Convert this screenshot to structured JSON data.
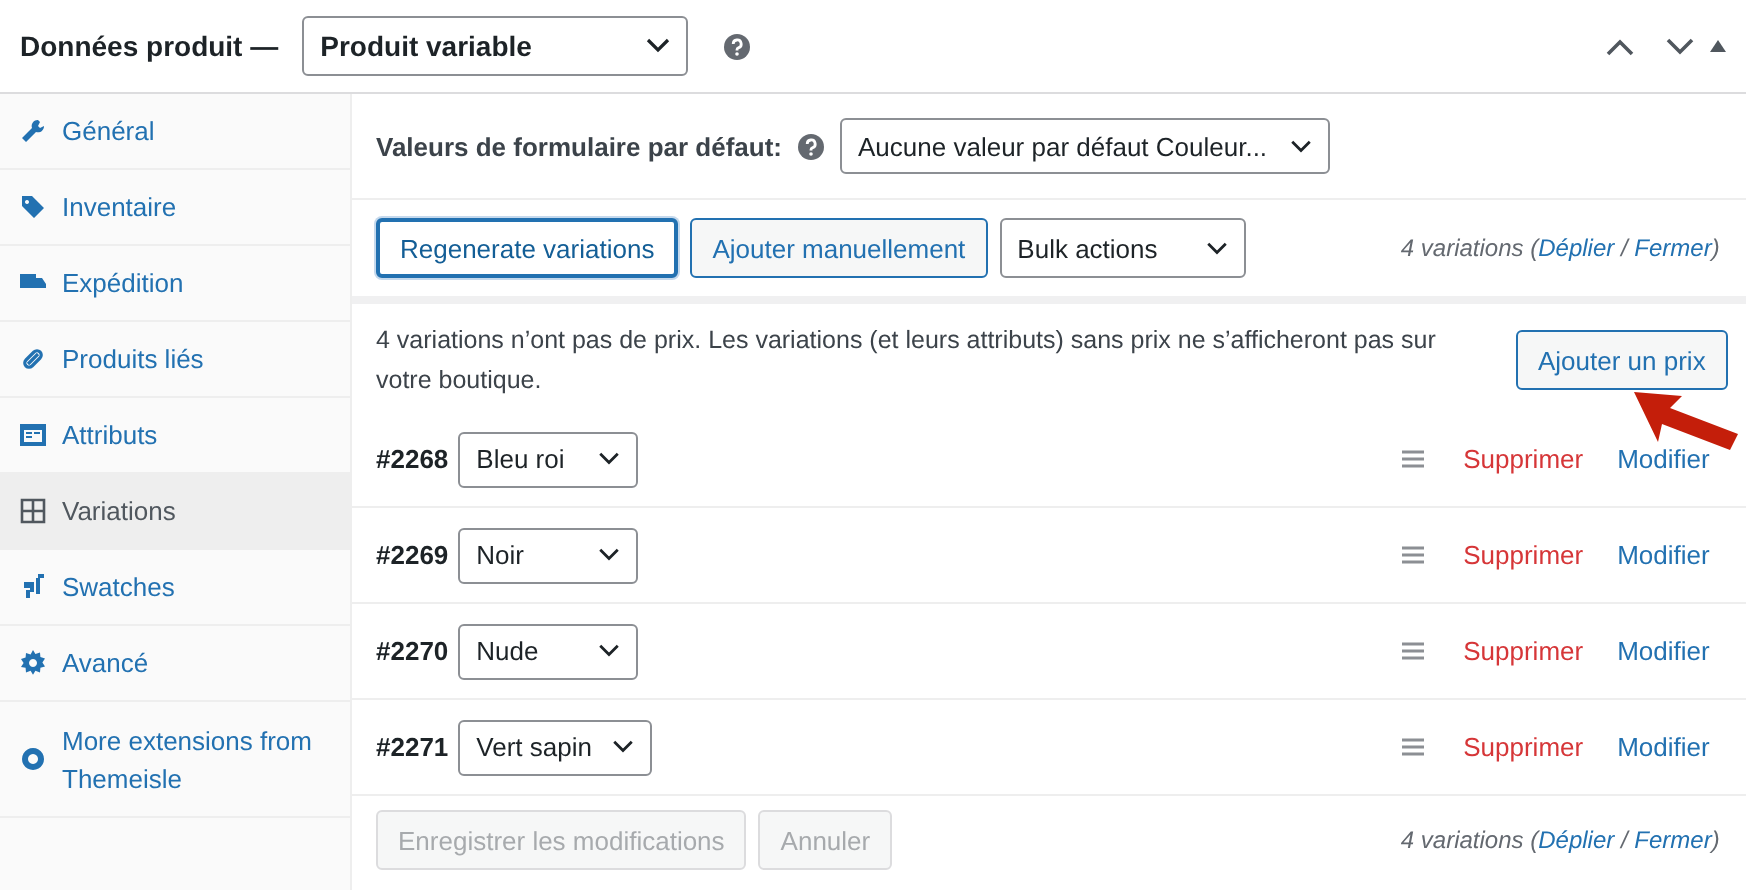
{
  "header": {
    "title": "Données produit —",
    "product_type": "Produit variable"
  },
  "sidebar": {
    "items": [
      {
        "label": "Général",
        "selected": false
      },
      {
        "label": "Inventaire",
        "selected": false
      },
      {
        "label": "Expédition",
        "selected": false
      },
      {
        "label": "Produits liés",
        "selected": false
      },
      {
        "label": "Attributs",
        "selected": false
      },
      {
        "label": "Variations",
        "selected": true
      },
      {
        "label": "Swatches",
        "selected": false
      },
      {
        "label": "Avancé",
        "selected": false
      },
      {
        "label": "More extensions from Themeisle",
        "selected": false
      }
    ]
  },
  "defaults": {
    "label": "Valeurs de formulaire par défaut:",
    "value": "Aucune valeur par défaut Couleur..."
  },
  "toolbar": {
    "buttons": [
      {
        "label": "Regenerate variations",
        "focused": true
      },
      {
        "label": "Ajouter manuellement",
        "focused": false
      }
    ],
    "bulk_select": "Bulk actions",
    "summary": {
      "count": "4 variations",
      "open": "(",
      "expand": "Déplier",
      "separator": "/",
      "collapse": "Fermer",
      "close": ")"
    }
  },
  "notice": {
    "text": "4 variations n’ont pas de prix. Les variations (et leurs attributs) sans prix ne s’afficheront pas sur votre boutique.",
    "button": "Ajouter un prix"
  },
  "variations": [
    {
      "id": "#2268",
      "value": "Bleu roi",
      "delete": "Supprimer",
      "edit": "Modifier"
    },
    {
      "id": "#2269",
      "value": "Noir",
      "delete": "Supprimer",
      "edit": "Modifier"
    },
    {
      "id": "#2270",
      "value": "Nude",
      "delete": "Supprimer",
      "edit": "Modifier"
    },
    {
      "id": "#2271",
      "value": "Vert sapin",
      "delete": "Supprimer",
      "edit": "Modifier"
    }
  ],
  "footer": {
    "save": {
      "label": "Enregistrer les modifications",
      "disabled": true
    },
    "cancel": {
      "label": "Annuler",
      "disabled": true
    },
    "summary": {
      "count": "4 variations",
      "open": "(",
      "expand": "Déplier",
      "separator": "/",
      "collapse": "Fermer",
      "close": ")"
    }
  }
}
